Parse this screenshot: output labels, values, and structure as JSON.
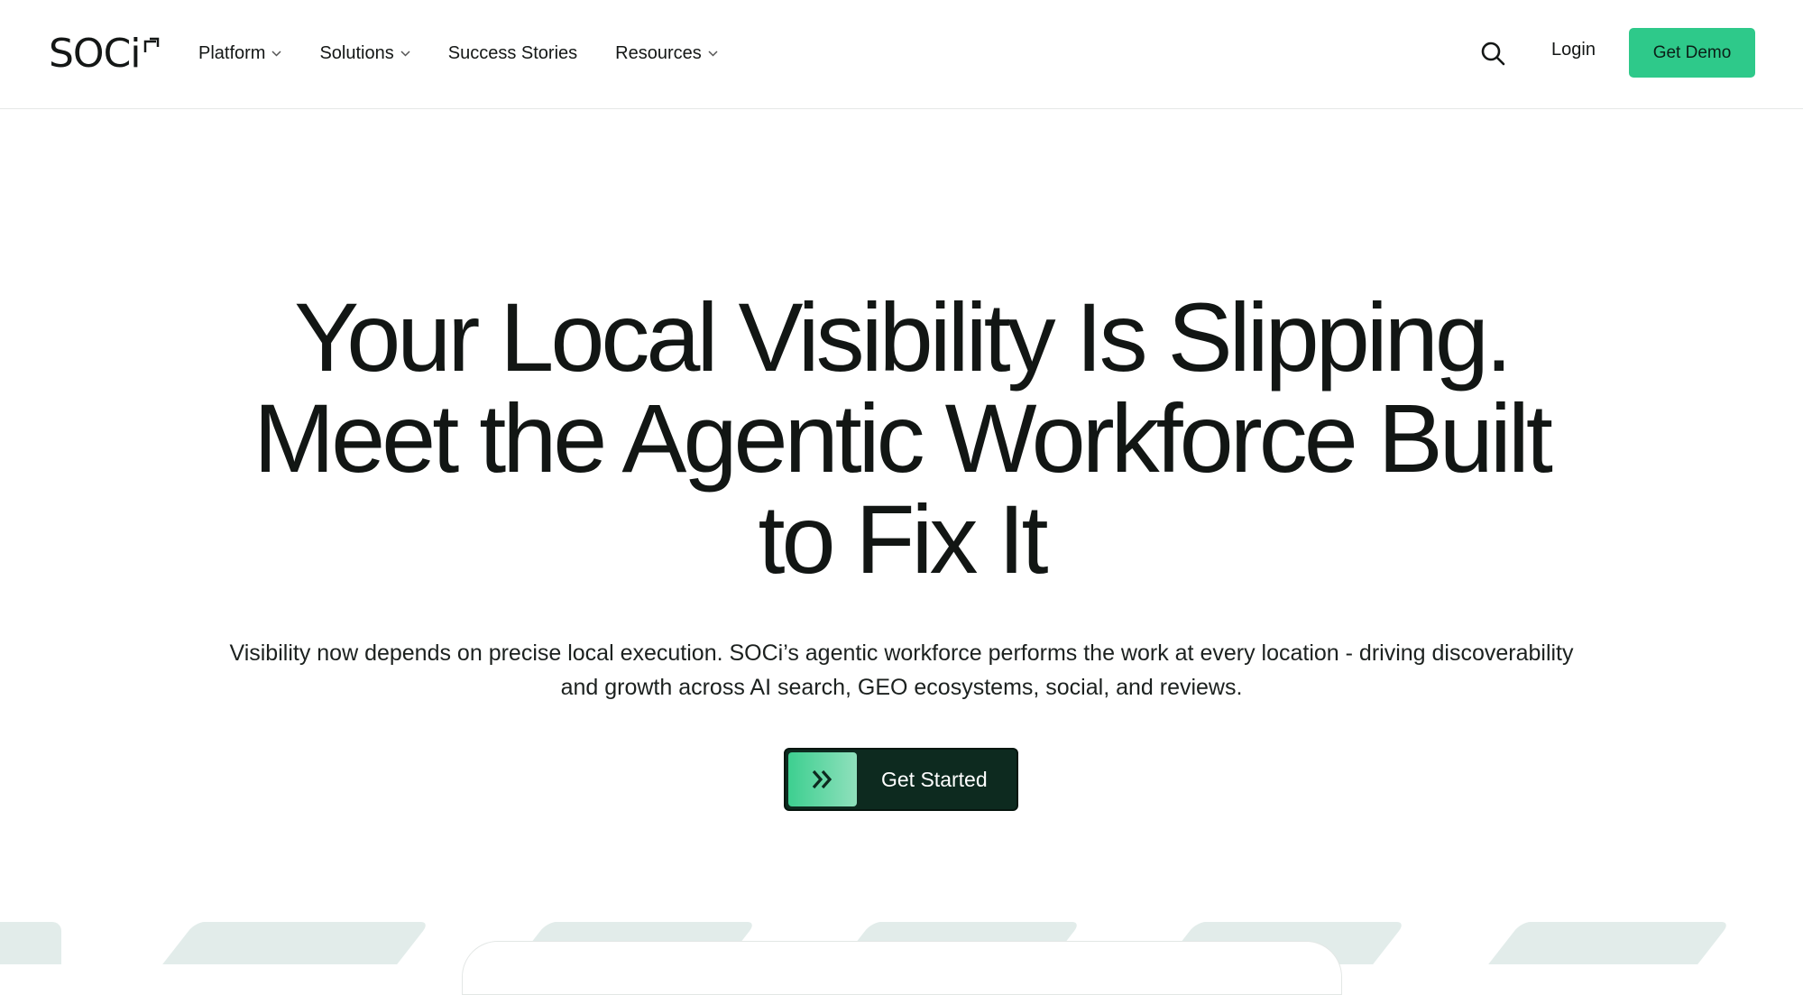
{
  "header": {
    "logo_text": "SOCi",
    "logo_trademark": "™",
    "nav": [
      {
        "label": "Platform",
        "has_dropdown": true
      },
      {
        "label": "Solutions",
        "has_dropdown": true
      },
      {
        "label": "Success Stories",
        "has_dropdown": false
      },
      {
        "label": "Resources",
        "has_dropdown": true
      }
    ],
    "search_icon": "search-icon",
    "login_label": "Login",
    "demo_label": "Get Demo"
  },
  "hero": {
    "title_lines": [
      "Your Local Visibility Is Slipping.",
      "Meet the Agentic Workforce Built",
      "to Fix It"
    ],
    "subtitle": "Visibility now depends on precise local execution. SOCi’s agentic workforce performs the work at every location - driving discoverability and growth across AI search, GEO ecosystems, social, and reviews.",
    "cta_label": "Get Started",
    "cta_icon": "double-chevron-right-icon"
  },
  "colors": {
    "accent": "#2ec98a",
    "cta_dark": "#0d2a1f",
    "text": "#121614",
    "tile": "#e2ecea"
  }
}
